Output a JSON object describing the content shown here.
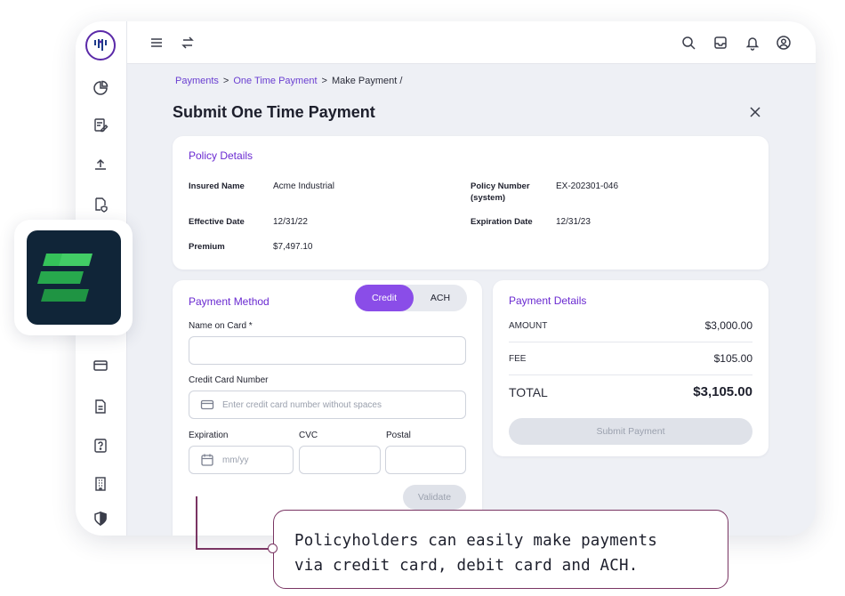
{
  "breadcrumb": {
    "item1": "Payments",
    "sep": ">",
    "item2": "One Time Payment",
    "item3": "Make Payment /"
  },
  "page_title": "Submit One Time Payment",
  "policy": {
    "title": "Policy Details",
    "insured_name_label": "Insured Name",
    "insured_name": "Acme Industrial",
    "policy_number_label_1": "Policy Number",
    "policy_number_label_2": "(system)",
    "policy_number": "EX-202301-046",
    "effective_date_label": "Effective Date",
    "effective_date": "12/31/22",
    "expiration_date_label": "Expiration Date",
    "expiration_date": "12/31/23",
    "premium_label": "Premium",
    "premium": "$7,497.10"
  },
  "payment_method": {
    "title": "Payment Method",
    "toggle_credit": "Credit",
    "toggle_ach": "ACH",
    "selected": "Credit",
    "name_label": "Name on Card *",
    "card_number_label": "Credit Card Number",
    "card_number_placeholder": "Enter credit card number without spaces",
    "expiration_label": "Expiration",
    "expiration_placeholder": "mm/yy",
    "cvc_label": "CVC",
    "postal_label": "Postal",
    "validate_button": "Validate"
  },
  "payment_details": {
    "title": "Payment Details",
    "amount_label": "AMOUNT",
    "amount": "$3,000.00",
    "fee_label": "FEE",
    "fee": "$105.00",
    "total_label": "TOTAL",
    "total": "$3,105.00",
    "submit_button": "Submit Payment"
  },
  "callout": {
    "line1": "Policyholders can easily make payments",
    "line2": "via credit card, debit card and ACH."
  },
  "colors": {
    "accent": "#6a2ad1",
    "toggle_active": "#8a4de8",
    "callout_border": "#7a3563",
    "logo_bg": "#102538",
    "logo_green": "#2bb24c"
  }
}
